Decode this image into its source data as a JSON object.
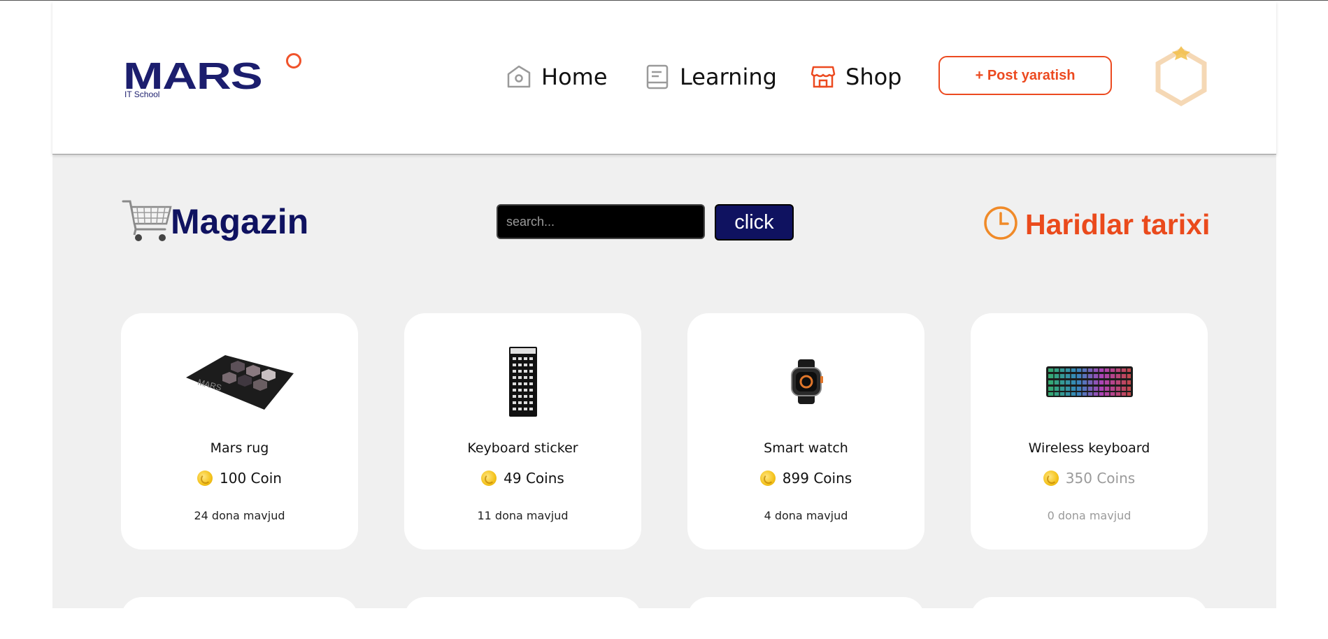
{
  "header": {
    "logo": {
      "text": "MARS",
      "sub": "IT School"
    },
    "nav": [
      {
        "label": "Home",
        "icon": "home-icon"
      },
      {
        "label": "Learning",
        "icon": "book-icon"
      },
      {
        "label": "Shop",
        "icon": "store-icon"
      }
    ],
    "post_button": "+ Post yaratish",
    "avatar_icon": "hexagon-avatar-icon"
  },
  "toolbar": {
    "title": "Magazin",
    "search_placeholder": "search...",
    "search_button": "click",
    "history_label": "Haridlar tarixi"
  },
  "products": [
    {
      "name": "Mars rug",
      "price": "100 Coin",
      "stock": "24 dona mavjud",
      "image": "mousepad-image",
      "available": true
    },
    {
      "name": "Keyboard sticker",
      "price": "49 Coins",
      "stock": "11 dona mavjud",
      "image": "sticker-image",
      "available": true
    },
    {
      "name": "Smart watch",
      "price": "899 Coins",
      "stock": "4 dona mavjud",
      "image": "watch-image",
      "available": true
    },
    {
      "name": "Wireless keyboard",
      "price": "350 Coins",
      "stock": "0 dona mavjud",
      "image": "keyboard-image",
      "available": false
    }
  ],
  "colors": {
    "brand_navy": "#0f1260",
    "accent_orange": "#ec4a20",
    "background": "#f0f0f0"
  }
}
